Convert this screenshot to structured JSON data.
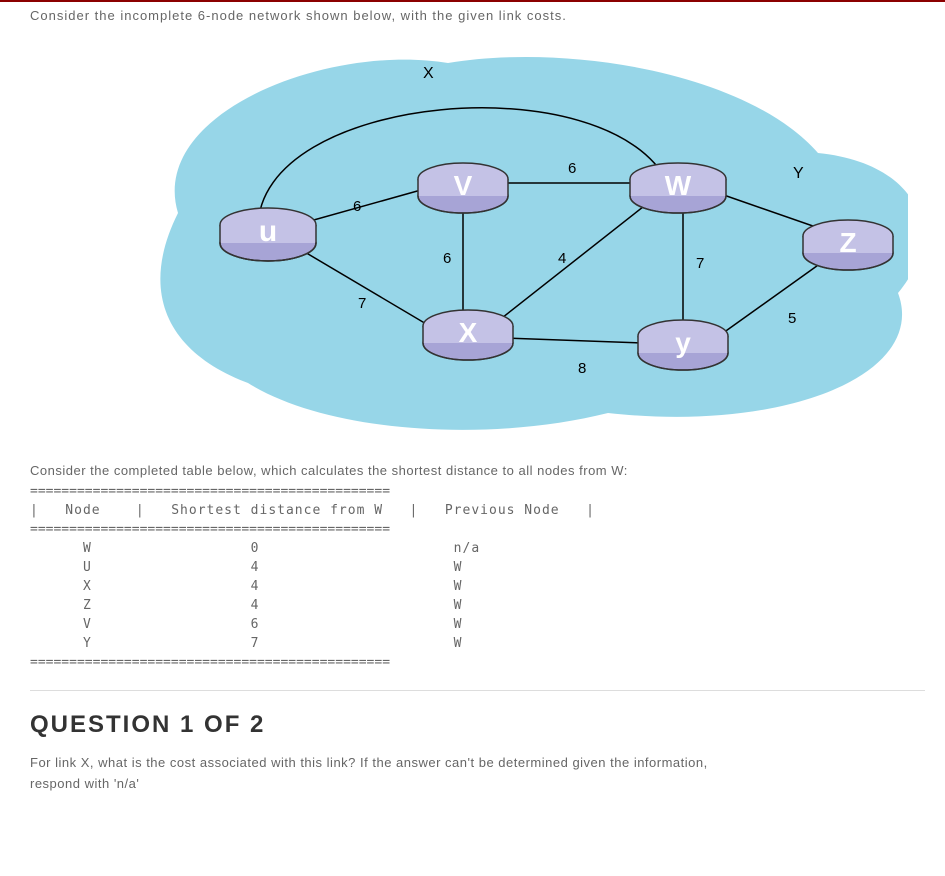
{
  "intro": "Consider the incomplete 6-node network shown below, with the given link costs.",
  "diagram": {
    "nodes": {
      "u": "u",
      "v": "V",
      "w": "W",
      "x": "X",
      "y": "y",
      "z": "Z"
    },
    "edge_labels": {
      "x": "X",
      "uv": "6",
      "vw": "6",
      "vx": "6",
      "ux": "7",
      "wx": "4",
      "wy": "7",
      "xy": "8",
      "yz": "5",
      "wz_label_y": "Y"
    }
  },
  "table": {
    "intro": "Consider the completed table below, which calculates the shortest distance to all nodes from W:",
    "divider": "==============================================",
    "header": "|   Node    |   Shortest distance from W   |   Previous Node   |",
    "rows": [
      {
        "node": "W",
        "dist": "0",
        "prev": "n/a"
      },
      {
        "node": "U",
        "dist": "4",
        "prev": "W"
      },
      {
        "node": "X",
        "dist": "4",
        "prev": "W"
      },
      {
        "node": "Z",
        "dist": "4",
        "prev": "W"
      },
      {
        "node": "V",
        "dist": "6",
        "prev": "W"
      },
      {
        "node": "Y",
        "dist": "7",
        "prev": "W"
      }
    ]
  },
  "question": {
    "heading": "QUESTION 1 OF 2",
    "text": "For link X, what is the cost associated with this link? If the answer can't be determined given the information, respond with 'n/a'"
  },
  "chart_data": {
    "type": "diagram",
    "description": "6-node undirected network graph with labeled link costs",
    "nodes": [
      "u",
      "v",
      "w",
      "x",
      "y",
      "z"
    ],
    "edges": [
      {
        "from": "u",
        "to": "v",
        "cost": 6
      },
      {
        "from": "u",
        "to": "x",
        "cost": 7
      },
      {
        "from": "u",
        "to": "w",
        "cost": "X",
        "note": "unknown link labeled X (curved top arc)"
      },
      {
        "from": "v",
        "to": "w",
        "cost": 6
      },
      {
        "from": "v",
        "to": "x",
        "cost": 6
      },
      {
        "from": "w",
        "to": "x",
        "cost": 4
      },
      {
        "from": "w",
        "to": "y",
        "cost": 7
      },
      {
        "from": "w",
        "to": "z",
        "cost": "Y",
        "note": "unknown link labeled Y"
      },
      {
        "from": "x",
        "to": "y",
        "cost": 8
      },
      {
        "from": "y",
        "to": "z",
        "cost": 5
      }
    ],
    "shortest_path_table_from": "W",
    "shortest_paths": [
      {
        "node": "W",
        "distance": 0,
        "previous": "n/a"
      },
      {
        "node": "U",
        "distance": 4,
        "previous": "W"
      },
      {
        "node": "X",
        "distance": 4,
        "previous": "W"
      },
      {
        "node": "Z",
        "distance": 4,
        "previous": "W"
      },
      {
        "node": "V",
        "distance": 6,
        "previous": "W"
      },
      {
        "node": "Y",
        "distance": 7,
        "previous": "W"
      }
    ]
  }
}
